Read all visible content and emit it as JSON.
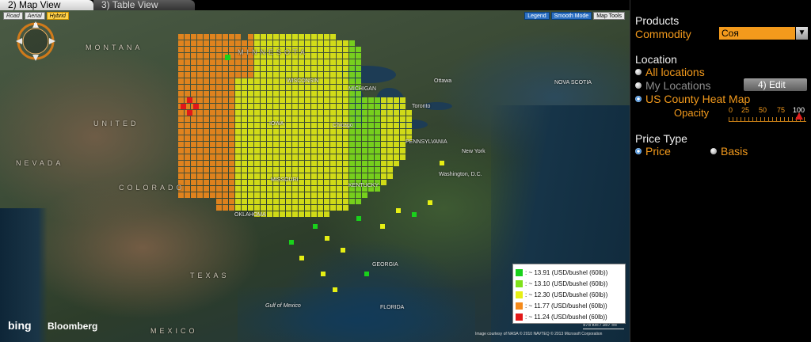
{
  "tabs": [
    {
      "label": "2) Map View",
      "active": true
    },
    {
      "label": "3) Table View",
      "active": false
    }
  ],
  "map": {
    "types": [
      "Road",
      "Aerial",
      "Hybrid"
    ],
    "active_type": "Hybrid",
    "controls": [
      "Legend",
      "Smooth Mode",
      "Map Tools"
    ],
    "compass_label": "N",
    "branding": {
      "bing": "bing",
      "bloomberg": "Bloomberg"
    },
    "scale": "575 km / 357 mi",
    "credits": "Image courtesy of NASA © 2010 NAVTEQ © 2013 Microsoft Corporation",
    "labels": {
      "montana": "MONTANA",
      "minnesota": "MINNESOTA",
      "wisconsin": "WISCONSIN",
      "michigan": "MICHIGAN",
      "iowa": "IOWA",
      "missouri": "MISSOURI",
      "kentucky": "KENTUCKY",
      "colorado": "COLORADO",
      "nevada": "NEVADA",
      "oklahoma": "OKLAHOMA",
      "texas": "TEXAS",
      "mexico": "MEXICO",
      "georgia": "GEORGIA",
      "florida": "FLORIDA",
      "pennsylvania": "PENNSYLVANIA",
      "new_york": "New York",
      "chicago": "Chicago",
      "united": "UNITED",
      "gulf_of_mexico": "Gulf of Mexico",
      "nova_scotia": "NOVA SCOTIA",
      "toronto": "Toronto",
      "ottawa": "Ottawa",
      "washington": "Washington, D.C."
    }
  },
  "legend": {
    "items": [
      {
        "text": ": ~ 13.91 (USD/bushel (60lb))",
        "color": "#19d11b"
      },
      {
        "text": ": ~ 13.10 (USD/bushel (60lb))",
        "color": "#7fe11a"
      },
      {
        "text": ": ~ 12.30 (USD/bushel (60lb))",
        "color": "#e6ef14"
      },
      {
        "text": ": ~ 11.77 (USD/bushel (60lb))",
        "color": "#f58a1a"
      },
      {
        "text": ": ~ 11.24 (USD/bushel (60lb))",
        "color": "#e21818"
      }
    ]
  },
  "panel": {
    "products_heading": "Products",
    "commodity_label": "Commodity",
    "commodity_value": "Соя",
    "location_heading": "Location",
    "location_options": [
      {
        "label": "All locations",
        "state": "enabled"
      },
      {
        "label": "My Locations",
        "state": "disabled"
      },
      {
        "label": "US County Heat Map",
        "state": "selected"
      }
    ],
    "edit_button": "4) Edit",
    "opacity_label": "Opacity",
    "opacity_ticks": [
      "0",
      "25",
      "50",
      "75",
      "100"
    ],
    "opacity_value": 100,
    "price_type_heading": "Price Type",
    "price_options": [
      {
        "label": "Price",
        "selected": true
      },
      {
        "label": "Basis",
        "selected": false
      }
    ]
  }
}
